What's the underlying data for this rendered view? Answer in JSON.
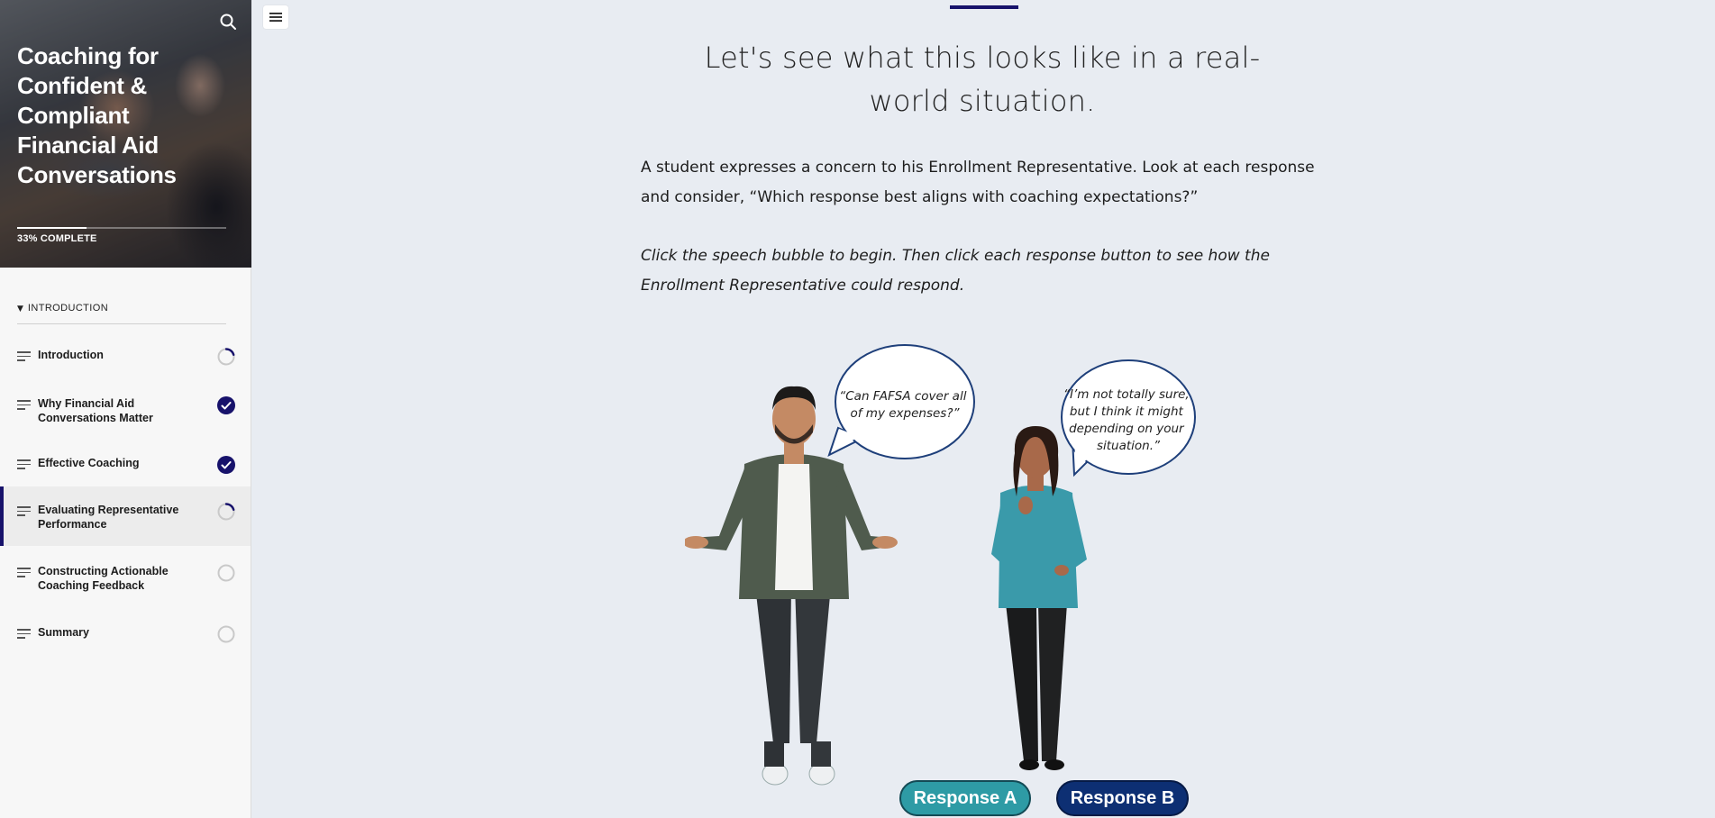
{
  "sidebar": {
    "course_title": "Coaching for Confident & Compliant Financial Aid Conversations",
    "progress_label": "33% COMPLETE",
    "progress_fraction": 0.33,
    "section_label": "INTRODUCTION",
    "lessons": [
      {
        "label": "Introduction",
        "status": "in-progress"
      },
      {
        "label": "Why Financial Aid Conversations Matter",
        "status": "complete"
      },
      {
        "label": "Effective Coaching",
        "status": "complete"
      },
      {
        "label": "Evaluating Representative Performance",
        "status": "in-progress",
        "active": true
      },
      {
        "label": "Constructing Actionable Coaching Feedback",
        "status": "not-started"
      },
      {
        "label": "Summary",
        "status": "not-started"
      }
    ]
  },
  "main": {
    "heading": "Let's see what this looks like in a real-world situation.",
    "intro": "A student expresses a concern to his Enrollment Representative. Look at each response and consider, “Which response best aligns with coaching expectations?”",
    "instructions": "Click the speech bubble to begin. Then click each response button to see how the Enrollment Representative could respond.",
    "student_bubble": [
      "“Can FAFSA cover all",
      "of my expenses?”"
    ],
    "rep_bubble": [
      "“I’m not totally sure,",
      "but I think it might",
      "depending on your",
      "situation.”"
    ],
    "response_a": "Response A",
    "response_b": "Response B"
  },
  "colors": {
    "accent": "#17126b",
    "response_a": "#2e9ba5",
    "response_b": "#0d2f73",
    "bubble_border": "#1e3f7a"
  },
  "icons": {
    "search": "search-icon",
    "menu": "hamburger-icon",
    "lesson": "lines-icon",
    "complete": "check-circle-icon",
    "in_progress": "partial-ring-icon",
    "not_started": "empty-ring-icon"
  }
}
